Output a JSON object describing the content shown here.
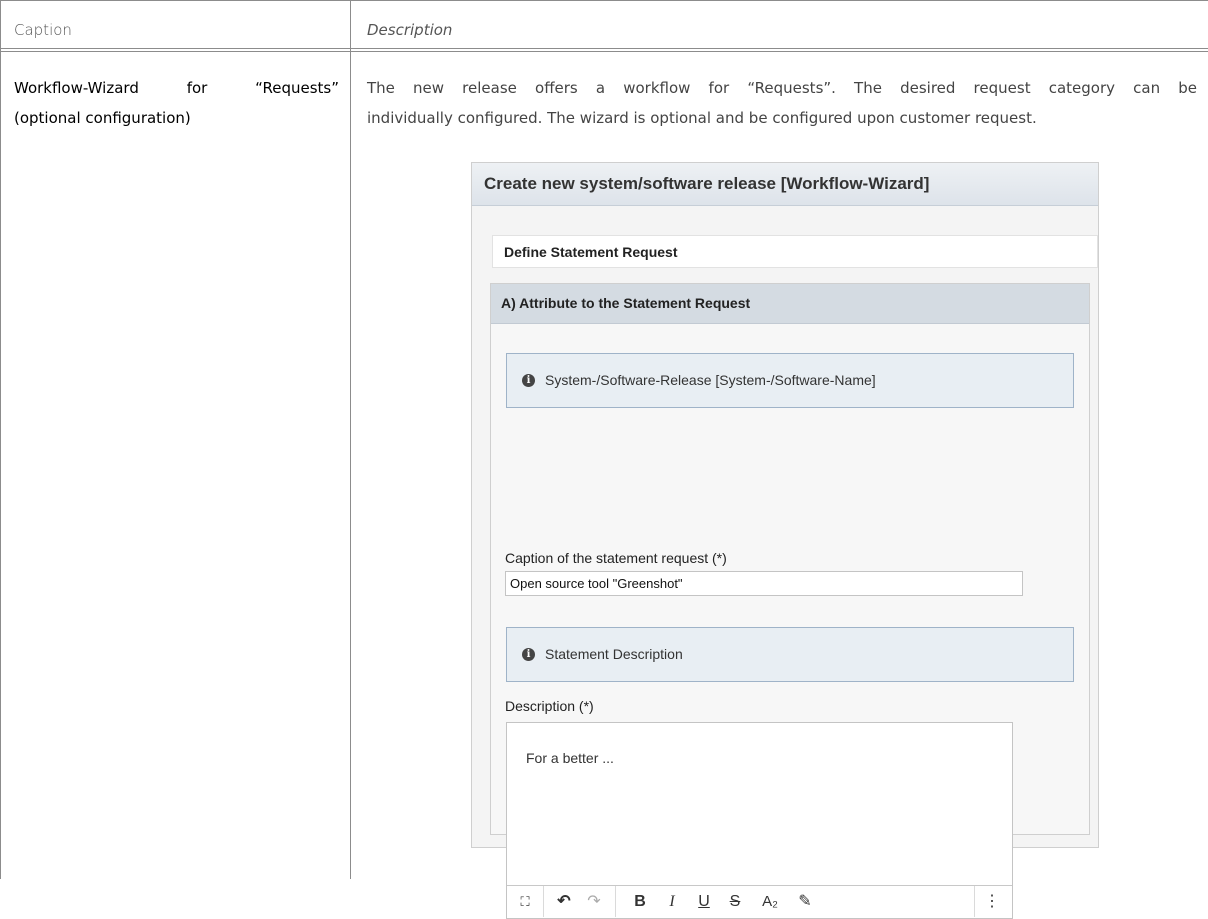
{
  "table": {
    "header": {
      "caption": "Caption",
      "description": "Description"
    },
    "row": {
      "caption_line1_words": [
        "Workflow-Wizard",
        "for",
        "“Requests”"
      ],
      "caption_line2": "(optional configuration)",
      "desc_line1": "The new release offers a workflow for “Requests”. The desired request category can be",
      "desc_line2": "individually configured. The wizard is optional and be configured upon customer request."
    }
  },
  "screenshot": {
    "title": "Create new system/software release [Workflow-Wizard]",
    "step_label": "Define Statement Request",
    "section_title": "A) Attribute to the Statement Request",
    "info_release": "System-/Software-Release [System-/Software-Name]",
    "caption_label": "Caption of the statement request (*)",
    "caption_value": "Open source tool \"Greenshot\"",
    "info_description": "Statement Description",
    "description_label": "Description (*)",
    "description_value": "For a better ...",
    "toolbar": {
      "fullscreen": "⛶",
      "undo": "↶",
      "redo": "↷",
      "bold": "B",
      "italic": "I",
      "underline": "U",
      "strike": "S",
      "subscript": "A₂",
      "highlight": "✎",
      "more": "⋮"
    },
    "colors": {
      "title_bar": "#dde3ea",
      "section_header": "#d4dbe2",
      "info_box": "#e8eef3",
      "info_border": "#9fb3c8"
    }
  }
}
